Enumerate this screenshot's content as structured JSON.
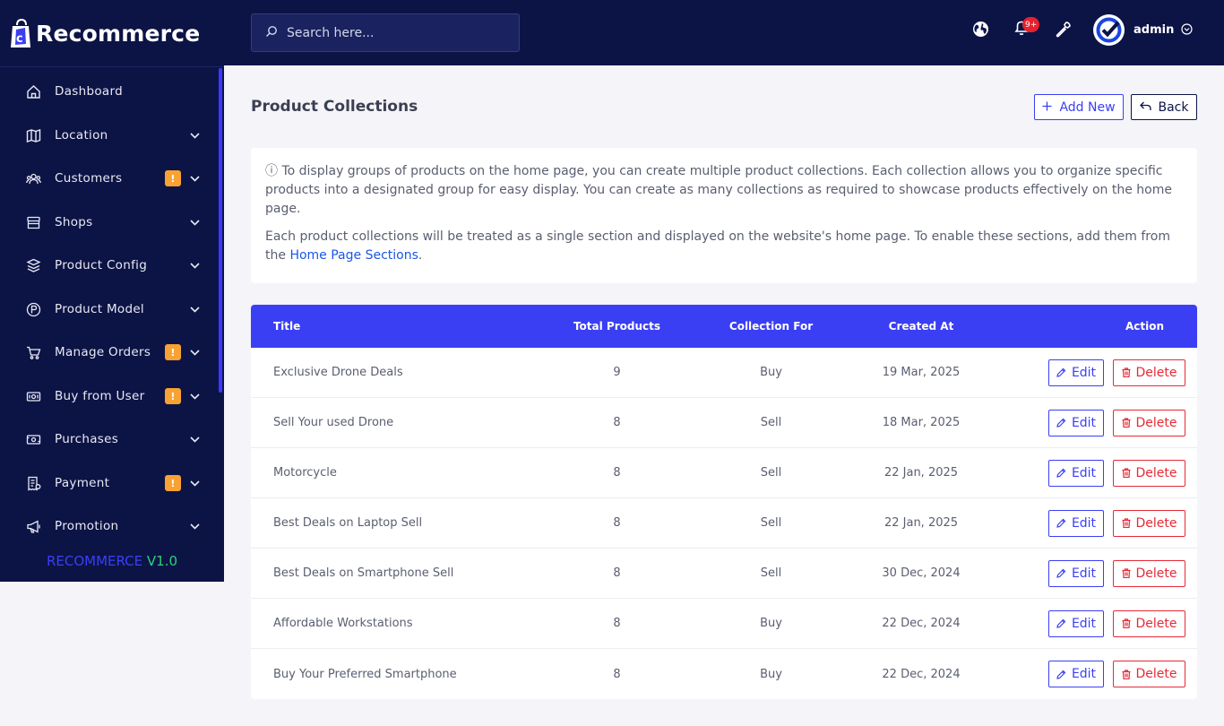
{
  "brand": {
    "name": "Recommerce"
  },
  "search": {
    "placeholder": "Search here..."
  },
  "header": {
    "notification_count": "9+",
    "user_name": "admin"
  },
  "sidebar": {
    "items": [
      {
        "label": "Dashboard",
        "icon": "home-icon",
        "badge": "",
        "chevron": false
      },
      {
        "label": "Location",
        "icon": "map-icon",
        "badge": "",
        "chevron": true
      },
      {
        "label": "Customers",
        "icon": "users-icon",
        "badge": "!",
        "chevron": true
      },
      {
        "label": "Shops",
        "icon": "shop-icon",
        "badge": "",
        "chevron": true
      },
      {
        "label": "Product Config",
        "icon": "cubes-icon",
        "badge": "",
        "chevron": true
      },
      {
        "label": "Product Model",
        "icon": "product-icon",
        "badge": "",
        "chevron": true
      },
      {
        "label": "Manage Orders",
        "icon": "cart-icon",
        "badge": "!",
        "chevron": true
      },
      {
        "label": "Buy from User",
        "icon": "cash-icon",
        "badge": "!",
        "chevron": true
      },
      {
        "label": "Purchases",
        "icon": "money-icon",
        "badge": "",
        "chevron": true
      },
      {
        "label": "Payment",
        "icon": "receipt-icon",
        "badge": "!",
        "chevron": true
      },
      {
        "label": "Promotion",
        "icon": "megaphone-icon",
        "badge": "",
        "chevron": true
      }
    ],
    "version_name": "RECOMMERCE",
    "version_number": "V1.0"
  },
  "page": {
    "title": "Product Collections",
    "add_label": "Add New",
    "back_label": "Back"
  },
  "info": {
    "paragraph1": "ⓘ To display groups of products on the home page, you can create multiple product collections. Each collection allows you to organize specific products into a designated group for easy display. You can create as many collections as required to showcase products effectively on the home page.",
    "paragraph2_prefix": "Each product collections will be treated as a single section and displayed on the website's home page. To enable these sections, add them from the ",
    "paragraph2_link": "Home Page Sections",
    "paragraph2_suffix": "."
  },
  "table": {
    "headers": {
      "title": "Title",
      "total": "Total Products",
      "for": "Collection For",
      "created": "Created At",
      "action": "Action"
    },
    "edit_label": "Edit",
    "delete_label": "Delete",
    "rows": [
      {
        "title": "Exclusive Drone Deals",
        "total": "9",
        "for": "Buy",
        "created": "19 Mar, 2025"
      },
      {
        "title": "Sell Your used Drone",
        "total": "8",
        "for": "Sell",
        "created": "18 Mar, 2025"
      },
      {
        "title": "Motorcycle",
        "total": "8",
        "for": "Sell",
        "created": "22 Jan, 2025"
      },
      {
        "title": "Best Deals on Laptop Sell",
        "total": "8",
        "for": "Sell",
        "created": "22 Jan, 2025"
      },
      {
        "title": "Best Deals on Smartphone Sell",
        "total": "8",
        "for": "Sell",
        "created": "30 Dec, 2024"
      },
      {
        "title": "Affordable Workstations",
        "total": "8",
        "for": "Buy",
        "created": "22 Dec, 2024"
      },
      {
        "title": "Buy Your Preferred Smartphone",
        "total": "8",
        "for": "Buy",
        "created": "22 Dec, 2024"
      }
    ]
  },
  "colors": {
    "navy": "#0c1446",
    "accent": "#3a3ff4",
    "danger": "#e52a36",
    "badge": "#f7a233",
    "version_green": "#2bd07a"
  }
}
